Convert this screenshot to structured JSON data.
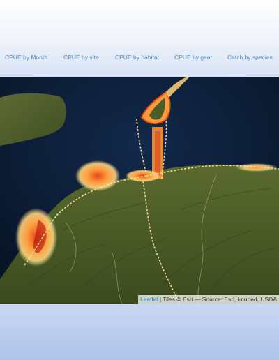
{
  "nav": {
    "tabs": [
      {
        "label": "CPUE by Month"
      },
      {
        "label": "CPUE by site"
      },
      {
        "label": "CPUE by habitat"
      },
      {
        "label": "CPUE by gear"
      },
      {
        "label": "Catch by species"
      }
    ]
  },
  "map": {
    "attribution": {
      "leaflet_label": "Leaflet",
      "separator": " | ",
      "tiles_text": "Tiles © Esri — Source: Esri, i-cubed, USDA"
    },
    "heatmap_colors": [
      "#fff3b0",
      "#ffd27a",
      "#ff9b3d",
      "#e24a1c",
      "#b8160e"
    ]
  }
}
